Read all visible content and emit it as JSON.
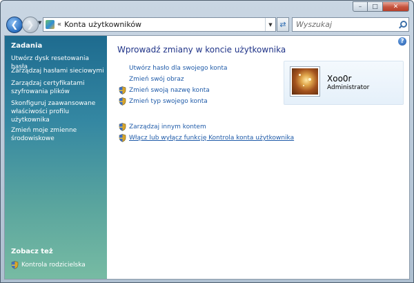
{
  "window": {
    "caption_buttons": {
      "minimize": "–",
      "maximize": "□",
      "close": "✕"
    }
  },
  "navbar": {
    "back_icon": "back-arrow-icon",
    "forward_icon": "forward-arrow-icon",
    "address": {
      "chevron": "«",
      "text": "Konta użytkowników"
    },
    "search": {
      "placeholder": "Wyszukaj"
    }
  },
  "sidebar": {
    "tasks_heading": "Zadania",
    "tasks": [
      "Utwórz dysk resetowania hasła",
      "Zarządzaj hasłami sieciowymi",
      "Zarządzaj certyfikatami szyfrowania plików",
      "Skonfiguruj zaawansowane właściwości profilu użytkownika",
      "Zmień moje zmienne środowiskowe"
    ],
    "see_also_heading": "Zobacz też",
    "see_also": [
      {
        "label": "Kontrola rodzicielska",
        "icon": "uac-shield-icon"
      }
    ]
  },
  "main": {
    "title": "Wprowadź zmiany w koncie użytkownika",
    "help": "?",
    "tasks": [
      {
        "label": "Utwórz hasło dla swojego konta",
        "shield": false
      },
      {
        "label": "Zmień swój obraz",
        "shield": false
      },
      {
        "label": "Zmień swoją nazwę konta",
        "shield": true
      },
      {
        "label": "Zmień typ swojego konta",
        "shield": true
      }
    ],
    "other_tasks": [
      {
        "label": "Zarządzaj innym kontem",
        "shield": true
      },
      {
        "label": "Włącz lub wyłącz funkcję Kontrola konta użytkownika",
        "shield": true
      }
    ],
    "user": {
      "name": "Xoo0r",
      "role": "Administrator"
    }
  },
  "colors": {
    "link": "#1e5aa8",
    "title": "#1e3287",
    "sidebar_top": "#1e6b8f",
    "sidebar_bottom": "#77bba3"
  }
}
